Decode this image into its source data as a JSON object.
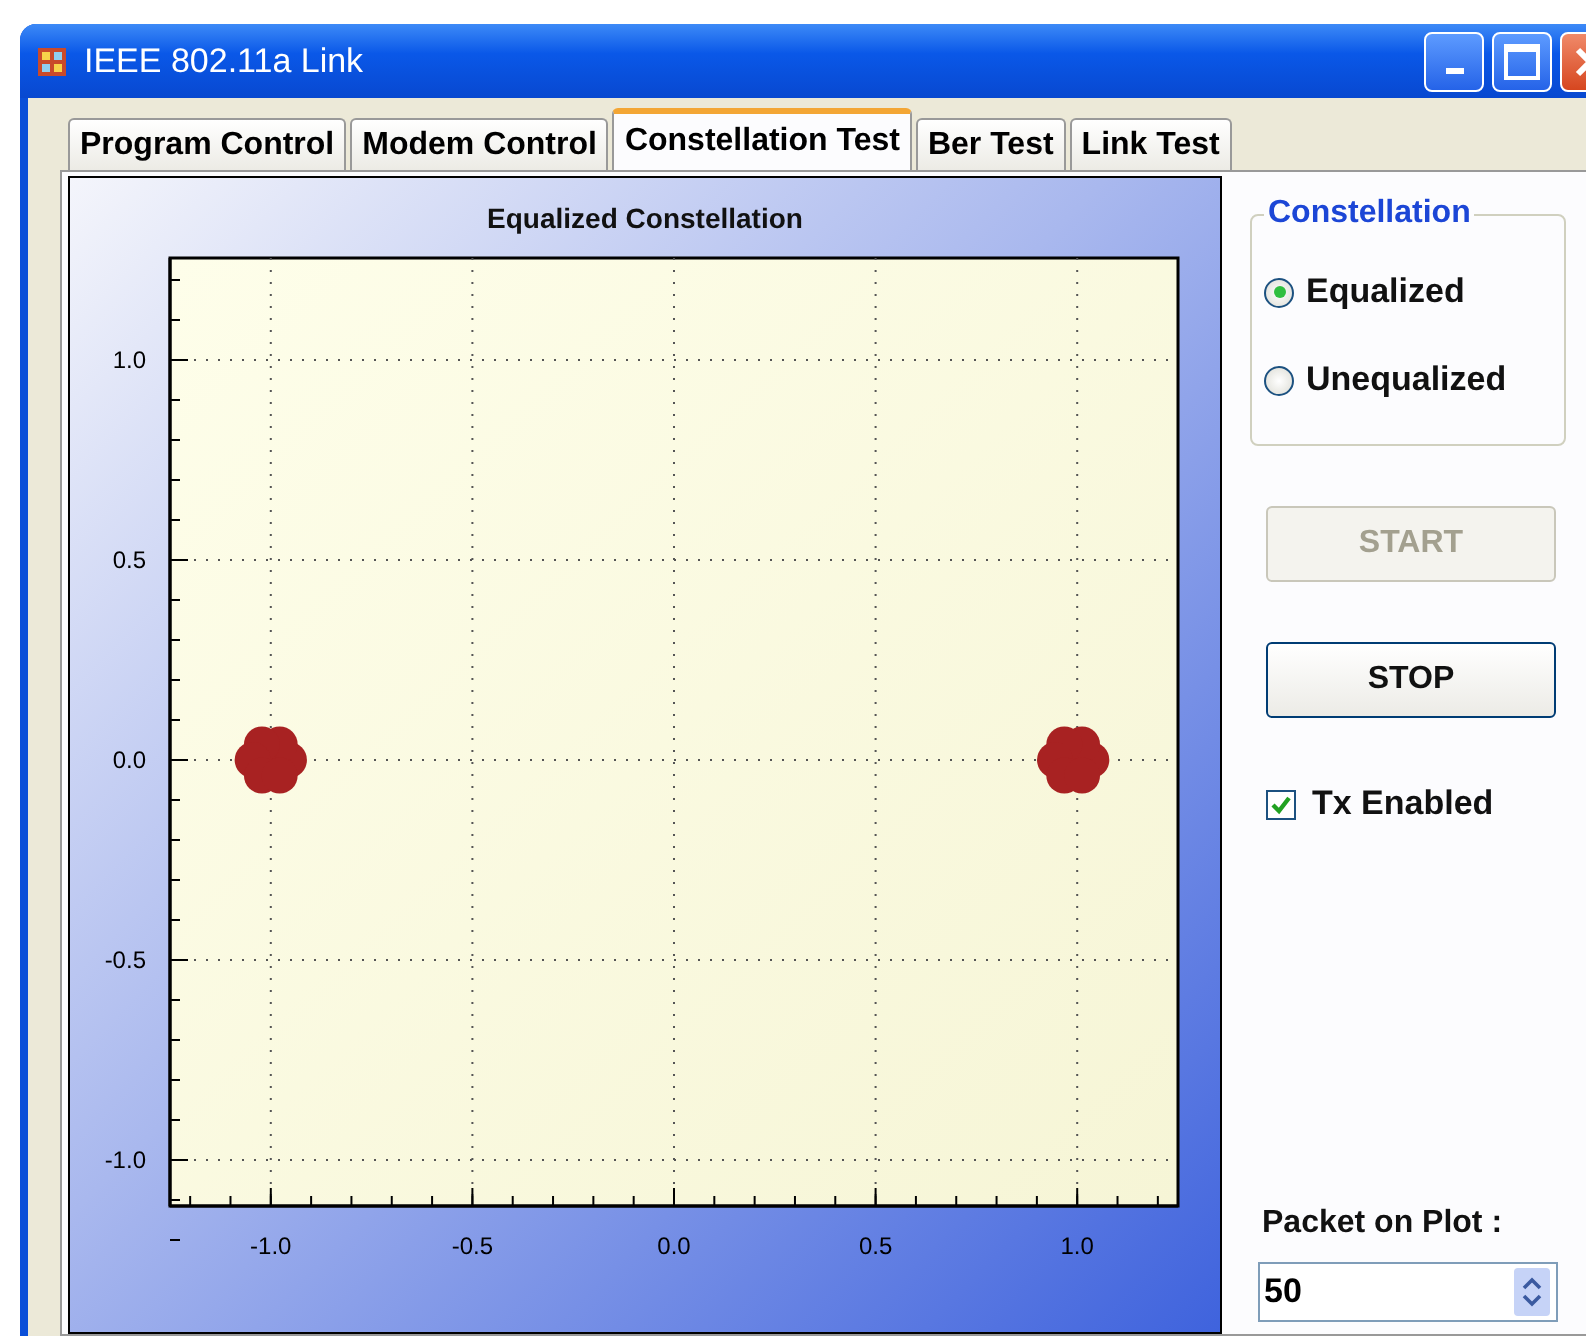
{
  "window": {
    "title": "IEEE 802.11a Link"
  },
  "tabs": [
    {
      "label": "Program Control",
      "selected": false
    },
    {
      "label": "Modem Control",
      "selected": false
    },
    {
      "label": "Constellation Test",
      "selected": true
    },
    {
      "label": "Ber Test",
      "selected": false
    },
    {
      "label": "Link Test",
      "selected": false
    }
  ],
  "chart": {
    "chart_data": {
      "type": "scatter",
      "title": "Equalized Constellation",
      "grid": true,
      "x": [
        -0.955,
        -0.978,
        -1.022,
        -1.045,
        -1.022,
        -0.978,
        1.035,
        1.012,
        0.968,
        0.945,
        0.968,
        1.012
      ],
      "series": [
        {
          "color": "#a82222",
          "values": [
            0.0,
            0.039,
            0.039,
            0.0,
            -0.039,
            -0.039,
            0.0,
            0.039,
            0.039,
            0.0,
            -0.039,
            -0.039
          ]
        }
      ],
      "xlim": [
        -1.25,
        1.25
      ],
      "ylim": [
        -1.115,
        1.255
      ],
      "xticks": [
        {
          "value": -1.0,
          "label": "-1.0"
        },
        {
          "value": -0.5,
          "label": "-0.5"
        },
        {
          "value": 0.0,
          "label": "0.0"
        },
        {
          "value": 0.5,
          "label": "0.5"
        },
        {
          "value": 1.0,
          "label": "1.0"
        }
      ],
      "yticks": [
        {
          "value": -1.0,
          "label": "-1.0"
        },
        {
          "value": -0.5,
          "label": "-0.5"
        },
        {
          "value": 0.0,
          "label": "0.0"
        },
        {
          "value": 0.5,
          "label": "0.5"
        },
        {
          "value": 1.0,
          "label": "1.0"
        }
      ]
    }
  },
  "constellation": {
    "title": "Constellation",
    "options": [
      {
        "label": "Equalized",
        "selected": true
      },
      {
        "label": "Unequalized",
        "selected": false
      }
    ]
  },
  "buttons": [
    {
      "label": "START",
      "disabled": true
    },
    {
      "label": "STOP",
      "disabled": false
    }
  ],
  "tx_enabled": {
    "label": "Tx Enabled",
    "checked": true
  },
  "packet": {
    "label": "Packet on Plot :",
    "value": "50"
  }
}
